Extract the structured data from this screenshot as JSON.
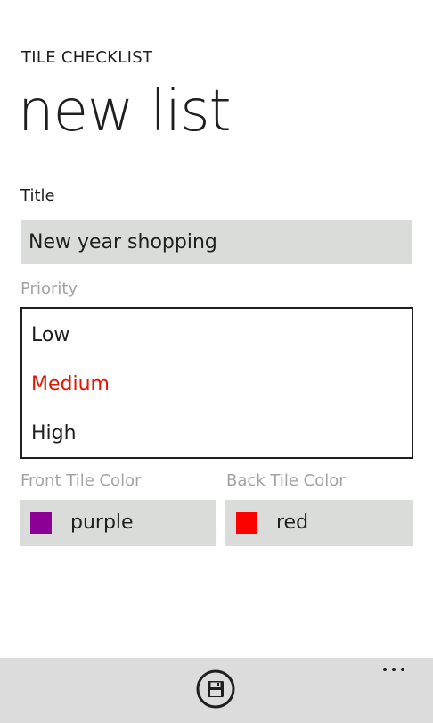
{
  "header": {
    "app_title": "TILE CHECKLIST",
    "page_title": "new list"
  },
  "title_field": {
    "label": "Title",
    "value": "New year shopping"
  },
  "priority": {
    "label": "Priority",
    "options": [
      "Low",
      "Medium",
      "High"
    ],
    "selected": "Medium",
    "accent_color": "#e51400"
  },
  "front_tile": {
    "label": "Front Tile Color",
    "value": "purple",
    "swatch_color": "#8c0095"
  },
  "back_tile": {
    "label": "Back Tile Color",
    "value": "red",
    "swatch_color": "#ff0000"
  },
  "app_bar": {
    "save_icon": "save-icon",
    "more_icon": "more-options-icon",
    "background": "#dcdcdc"
  }
}
